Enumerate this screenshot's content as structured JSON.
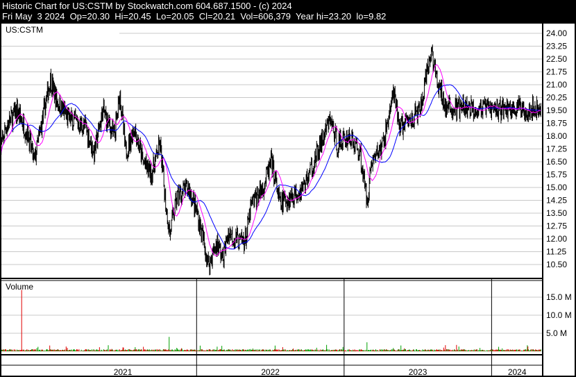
{
  "header": {
    "title": "Historic Chart for US:CSTM by Stockwatch.com 604.687.1500 - (c) 2024",
    "date": "Fri May  3 2024",
    "open": "Op=20.30",
    "high": "Hi=20.45",
    "low": "Lo=20.05",
    "close": "Cl=20.21",
    "volume": "Vol=606,379",
    "year_hi": "Year hi=23.20",
    "year_lo": "lo=9.82"
  },
  "chart_data": {
    "type": "line",
    "symbol_label": "US:CSTM",
    "volume_label": "Volume",
    "price_ticks": [
      "24.00",
      "23.25",
      "22.50",
      "21.75",
      "21.00",
      "20.25",
      "19.50",
      "18.75",
      "18.00",
      "17.25",
      "16.50",
      "15.75",
      "15.00",
      "14.25",
      "13.50",
      "12.75",
      "12.00",
      "11.25",
      "10.50"
    ],
    "price_range": [
      10.0,
      24.3
    ],
    "volume_ticks": [
      "15.0 M",
      "10.0 M",
      "5.0 M"
    ],
    "volume_range": [
      0,
      20000000
    ],
    "x_range": [
      2020.667,
      2024.337
    ],
    "year_labels": [
      "2021",
      "2022",
      "2023",
      "2024"
    ],
    "colors": {
      "up": "#00a000",
      "down": "#e00000",
      "bar": "#000000",
      "ma_short": "#ff00ff",
      "ma_long": "#0000ff",
      "grid": "#c8c8c8"
    },
    "price_waypoints": [
      [
        2020.667,
        17.0
      ],
      [
        2020.705,
        18.5
      ],
      [
        2020.783,
        19.5
      ],
      [
        2020.86,
        18.0
      ],
      [
        2020.899,
        16.5
      ],
      [
        2021.008,
        21.3
      ],
      [
        2021.054,
        20.0
      ],
      [
        2021.132,
        19.0
      ],
      [
        2021.248,
        18.5
      ],
      [
        2021.306,
        17.0
      ],
      [
        2021.364,
        19.5
      ],
      [
        2021.442,
        18.0
      ],
      [
        2021.481,
        20.5
      ],
      [
        2021.519,
        17.0
      ],
      [
        2021.578,
        18.5
      ],
      [
        2021.636,
        16.5
      ],
      [
        2021.694,
        15.8
      ],
      [
        2021.752,
        17.5
      ],
      [
        2021.791,
        14.0
      ],
      [
        2021.818,
        12.3
      ],
      [
        2021.868,
        14.5
      ],
      [
        2021.946,
        15.0
      ],
      [
        2022.004,
        13.5
      ],
      [
        2022.043,
        12.0
      ],
      [
        2022.081,
        10.5
      ],
      [
        2022.14,
        11.8
      ],
      [
        2022.178,
        10.8
      ],
      [
        2022.217,
        12.4
      ],
      [
        2022.295,
        11.8
      ],
      [
        2022.333,
        12.0
      ],
      [
        2022.372,
        14.0
      ],
      [
        2022.45,
        15.0
      ],
      [
        2022.508,
        16.5
      ],
      [
        2022.566,
        14.0
      ],
      [
        2022.643,
        14.5
      ],
      [
        2022.721,
        15.0
      ],
      [
        2022.798,
        16.5
      ],
      [
        2022.907,
        19.0
      ],
      [
        2022.953,
        17.5
      ],
      [
        2023.031,
        18.0
      ],
      [
        2023.109,
        17.0
      ],
      [
        2023.155,
        14.2
      ],
      [
        2023.186,
        16.5
      ],
      [
        2023.264,
        17.5
      ],
      [
        2023.333,
        20.5
      ],
      [
        2023.38,
        18.5
      ],
      [
        2023.457,
        19.0
      ],
      [
        2023.516,
        19.5
      ],
      [
        2023.593,
        23.0
      ],
      [
        2023.632,
        21.0
      ],
      [
        2023.671,
        20.2
      ],
      [
        2023.69,
        19.6
      ]
    ],
    "volume_spikes": [
      [
        2020.814,
        17000000
      ],
      [
        2021.814,
        4000000
      ],
      [
        2023.155,
        2500000
      ]
    ],
    "moving_averages": [
      "short",
      "long"
    ]
  }
}
